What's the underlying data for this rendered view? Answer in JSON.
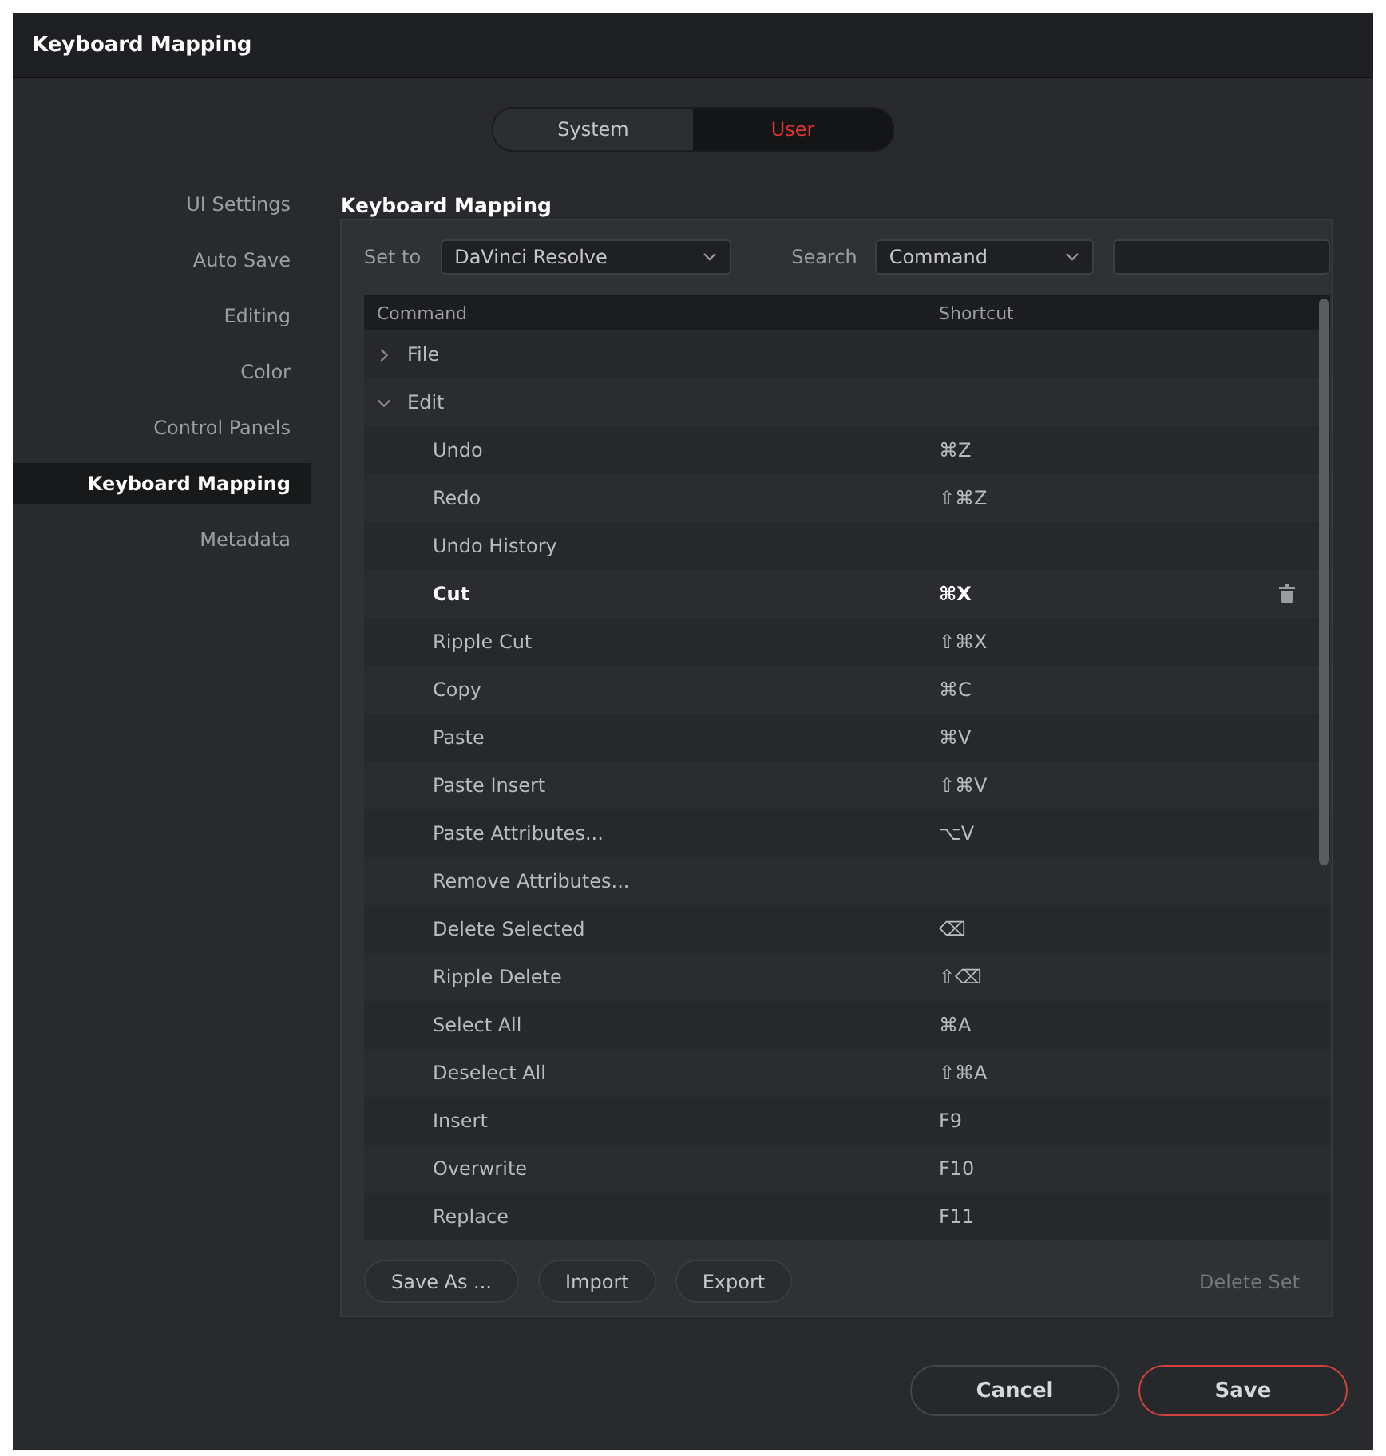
{
  "window": {
    "title": "Keyboard Mapping"
  },
  "scope_toggle": [
    {
      "label": "System",
      "selected": false
    },
    {
      "label": "User",
      "selected": true
    }
  ],
  "sidebar": {
    "items": [
      {
        "label": "UI Settings",
        "selected": false
      },
      {
        "label": "Auto Save",
        "selected": false
      },
      {
        "label": "Editing",
        "selected": false
      },
      {
        "label": "Color",
        "selected": false
      },
      {
        "label": "Control Panels",
        "selected": false
      },
      {
        "label": "Keyboard Mapping",
        "selected": true
      },
      {
        "label": "Metadata",
        "selected": false
      }
    ]
  },
  "panel": {
    "title": "Keyboard Mapping",
    "set_to": {
      "label": "Set to",
      "value": "DaVinci Resolve"
    },
    "search": {
      "label": "Search",
      "value": "Command"
    },
    "table": {
      "columns": [
        "Command",
        "Shortcut"
      ],
      "rows": [
        {
          "command": "File",
          "expanded": false,
          "children": []
        },
        {
          "command": "Edit",
          "expanded": true,
          "children": [
            {
              "command": "Undo",
              "shortcut": "⌘Z",
              "selected": false
            },
            {
              "command": "Redo",
              "shortcut": "⇧⌘Z",
              "selected": false
            },
            {
              "command": "Undo History",
              "selected": false
            },
            {
              "command": "Cut",
              "shortcut": "⌘X",
              "selected": true
            },
            {
              "command": "Ripple Cut",
              "shortcut": "⇧⌘X",
              "selected": false
            },
            {
              "command": "Copy",
              "shortcut": "⌘C",
              "selected": false
            },
            {
              "command": "Paste",
              "shortcut": "⌘V",
              "selected": false
            },
            {
              "command": "Paste Insert",
              "shortcut": "⇧⌘V",
              "selected": false
            },
            {
              "command": "Paste Attributes...",
              "shortcut": "⌥V",
              "selected": false
            },
            {
              "command": "Remove Attributes...",
              "selected": false
            },
            {
              "command": "Delete Selected",
              "shortcut": "⌫",
              "selected": false
            },
            {
              "command": "Ripple Delete",
              "shortcut": "⇧⌫",
              "selected": false
            },
            {
              "command": "Select All",
              "shortcut": "⌘A",
              "selected": false
            },
            {
              "command": "Deselect All",
              "shortcut": "⇧⌘A",
              "selected": false
            },
            {
              "command": "Insert",
              "shortcut": "F9",
              "selected": false
            },
            {
              "command": "Overwrite",
              "shortcut": "F10",
              "selected": false
            },
            {
              "command": "Replace",
              "shortcut": "F11",
              "selected": false
            }
          ]
        }
      ]
    },
    "buttons": [
      {
        "label": "Save As ...",
        "disabled": false
      },
      {
        "label": "Import",
        "disabled": false
      },
      {
        "label": "Export",
        "disabled": false
      }
    ],
    "delete_set": {
      "label": "Delete Set",
      "disabled": true
    }
  },
  "footer": {
    "cancel": "Cancel",
    "save": "Save"
  }
}
